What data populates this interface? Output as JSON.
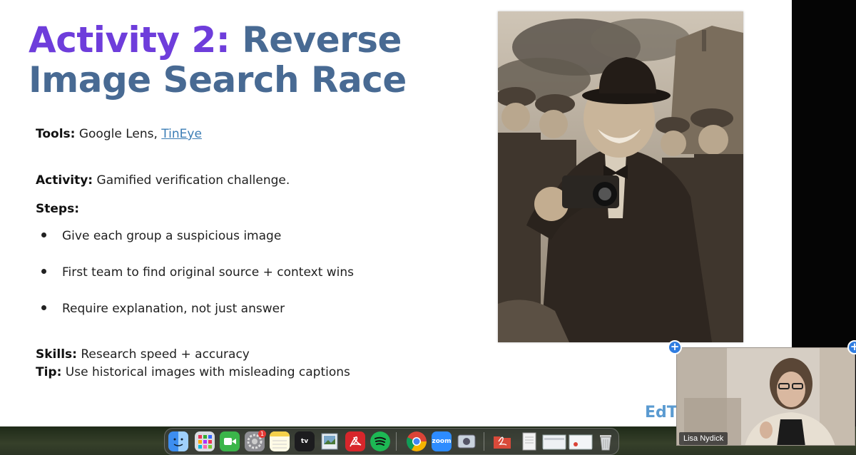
{
  "slide": {
    "title_accent": "Activity 2:",
    "title_rest_line1": "Reverse",
    "title_line2": "Image Search Race",
    "tools_label": "Tools:",
    "tools_text": "Google Lens, ",
    "tools_link": "TinEye",
    "activity_label": "Activity:",
    "activity_text": "Gamified verification challenge.",
    "steps_label": "Steps:",
    "steps": [
      "Give each group a suspicious image",
      "First team to find original source + context wins",
      "Require explanation, not just answer"
    ],
    "skills_label": "Skills:",
    "skills_text": "Research speed + accuracy",
    "tip_label": "Tip:",
    "tip_text": "Use historical images with misleading captions",
    "logo_partial": "EdT"
  },
  "dock": {
    "items": [
      {
        "name": "finder-icon",
        "color": "#3d8ef0"
      },
      {
        "name": "launchpad-icon",
        "color": "#9aa3ad"
      },
      {
        "name": "facetime-icon",
        "color": "#3bb54a"
      },
      {
        "name": "system-settings-icon",
        "color": "#8e8e93"
      },
      {
        "name": "notes-icon",
        "color": "#f5d04a"
      },
      {
        "name": "apple-tv-icon",
        "color": "#1c1c1e",
        "label": "tv"
      },
      {
        "name": "preview-icon",
        "color": "#7aa6c9"
      },
      {
        "name": "acrobat-icon",
        "color": "#d8262b"
      },
      {
        "name": "spotify-icon",
        "color": "#1db954"
      },
      {
        "name": "chrome-icon",
        "color": "#ffffff"
      },
      {
        "name": "zoom-icon",
        "color": "#2d8cff",
        "label": "zoom"
      },
      {
        "name": "screenshot-icon",
        "color": "#c9d3dd"
      },
      {
        "name": "downloads-folder-icon",
        "color": "#d94a3a"
      },
      {
        "name": "document-icon",
        "color": "#e6e6e6"
      },
      {
        "name": "window-thumbnail-icon",
        "color": "#dfe3e8"
      },
      {
        "name": "window-thumbnail-icon",
        "color": "#e8ecf0"
      },
      {
        "name": "trash-icon",
        "color": "#b8bcc2"
      }
    ],
    "settings_badge": "1"
  },
  "video": {
    "participant_name": "Lisa Nydick"
  }
}
